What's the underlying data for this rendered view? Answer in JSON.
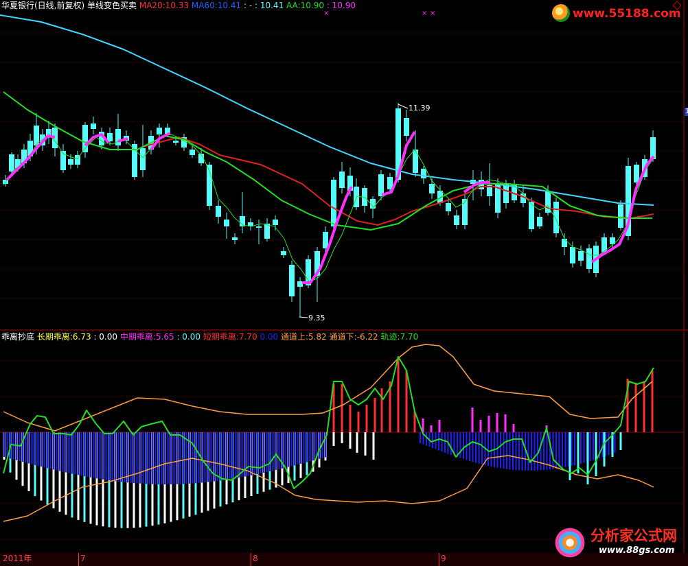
{
  "colors": {
    "up": "#ff3030",
    "down": "#54fcfc",
    "ma20": "#ff2020",
    "ma60": "#40d8ff",
    "green": "#20e020",
    "magenta": "#ff30ff",
    "orange": "#ffa040",
    "blue": "#2020ff",
    "white": "#ffffff",
    "grid": "#7a0000",
    "frame": "#b00000",
    "watermark_red": "#ff2020",
    "watermark_orange": "#ff7000"
  },
  "main_panel": {
    "header": {
      "stock": "华夏银行(日线,前复权)",
      "indicator": "单线变色买卖",
      "ma20_label": "MA20:",
      "ma20_value": "10.33",
      "ma60_label": "MA60:",
      "ma60_value": "10.41",
      "colon_item": ": - : 10.41",
      "aa_label": "AA:",
      "aa_value": "10.90",
      "colon_item2": ": 10.90"
    },
    "high_label": "11.39",
    "low_label": "9.35",
    "right_edge_marker": "1",
    "watermark": "www.55188.com"
  },
  "sub_panel": {
    "header": {
      "name": "乖离抄底",
      "long_label": "长期乖离:",
      "long_value": "6.73",
      "long_zero": ": 0.00",
      "mid_label": "中期乖离:",
      "mid_value": "5.65",
      "mid_zero": ": 0.00",
      "short_label": "短期乖离:",
      "short_value": "7.70",
      "short_zero": "0.00",
      "up_label": "通道上:",
      "up_value": "5.82",
      "down_label": "通道下:",
      "down_value": "-6.22",
      "track_label": "轨迹:",
      "track_value": "7.70"
    }
  },
  "time_axis": {
    "year": "2011年",
    "months": [
      "7",
      "8",
      "9"
    ]
  },
  "footer_logo": {
    "text": "分析家公式网",
    "url": "www.88gs.com"
  }
}
